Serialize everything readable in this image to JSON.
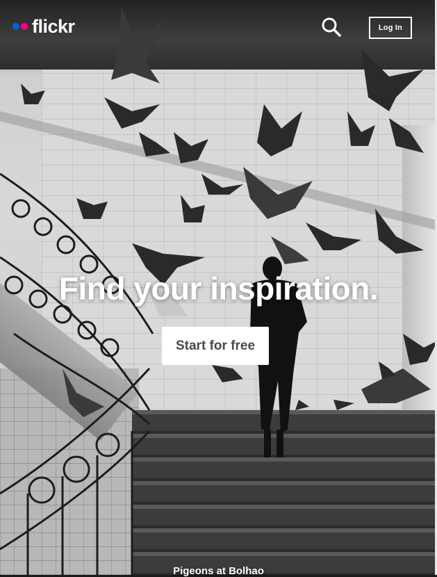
{
  "header": {
    "logo_text": "flickr",
    "logo_dot_colors": [
      "#0063dc",
      "#ff0084"
    ],
    "search_icon": "search-icon",
    "login_label": "Log In"
  },
  "hero": {
    "headline": "Find your inspiration.",
    "cta_label": "Start for free",
    "photo_caption": "Pigeons at Bolhao"
  }
}
